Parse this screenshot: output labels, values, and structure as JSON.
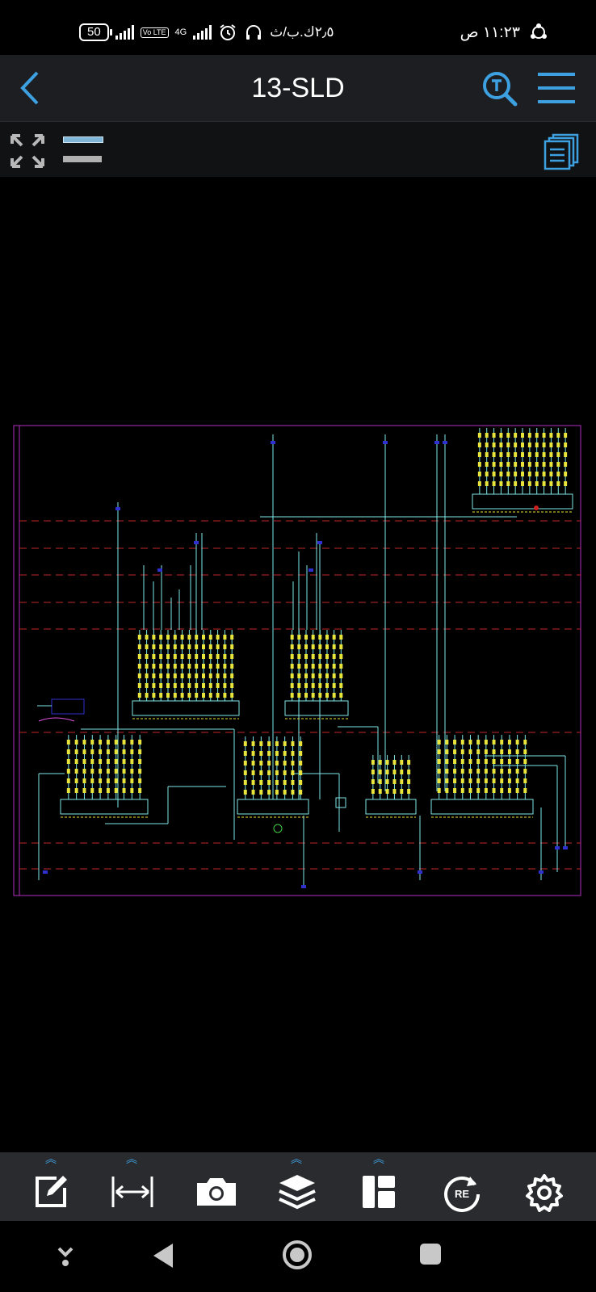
{
  "status_bar": {
    "battery": "50",
    "network": "4G",
    "volte": "Vo LTE",
    "data_speed": "٢٫٥ك.ب/ث",
    "time": "١١:٢٣ ص"
  },
  "header": {
    "title": "13-SLD"
  },
  "bottom_toolbar": {
    "redo_label": "RE"
  },
  "colors": {
    "toolbar_bg": "#1d1e21",
    "accent_blue": "#3da0e0",
    "border_magenta": "#b02ec0",
    "dashed_red": "#c0282a",
    "wire_cyan": "#7fe7e7",
    "component_yellow": "#e8e43a"
  },
  "icons": {
    "back": "chevron-left-icon",
    "search": "text-search-icon",
    "menu": "hamburger-menu-icon",
    "fullscreen": "expand-arrows-icon",
    "layouts": "documents-stack-icon",
    "edit": "edit-icon",
    "measure": "measure-icon",
    "camera": "camera-icon",
    "layers": "layers-icon",
    "panel": "layout-panel-icon",
    "redo": "redo-icon",
    "settings": "gear-icon"
  }
}
